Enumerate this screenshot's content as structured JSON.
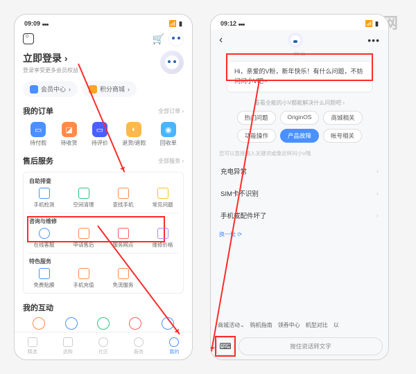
{
  "watermark": "爱创根知识网",
  "left": {
    "status": {
      "time": "09:09"
    },
    "login": {
      "title": "立即登录",
      "arrow": "›",
      "subtitle": "登录享受更多会员权益"
    },
    "pills": {
      "member": "会员中心",
      "points": "积分商城",
      "chev": "›"
    },
    "orders": {
      "title": "我的订单",
      "more": "全部订单 ›",
      "items": [
        "待付款",
        "待收货",
        "待评价",
        "退货/退款",
        "回收单"
      ]
    },
    "services": {
      "title": "售后服务",
      "more": "全部服务 ›",
      "group1": {
        "label": "自助排查",
        "items": [
          "手机检测",
          "空间清理",
          "查找手机",
          "常见问题"
        ]
      },
      "group2": {
        "label": "咨询与维修",
        "items": [
          "在线客服",
          "申请售后",
          "服务网点",
          "维修价格"
        ]
      },
      "group3": {
        "label": "特色服务",
        "items": [
          "免费贴膜",
          "手机充值",
          "免流服务"
        ]
      }
    },
    "inter": {
      "title": "我的互动"
    },
    "nav": [
      "精选",
      "选购",
      "社区",
      "服务",
      "我的"
    ]
  },
  "right": {
    "status": {
      "time": "09:12"
    },
    "chat_time": "09:11",
    "bubble": "Hi，亲爱的V粉，新年快乐！有什么问题，不妨问问小V吧~",
    "help": "看看全能的小V都能解决什么问题吧 ›",
    "chips": [
      "热门问题",
      "OriginOS",
      "商城相关",
      "功能操作",
      "产品故障",
      "帐号相关"
    ],
    "hint": "您可以直接输入关键词或像这样问小V哦",
    "list": [
      "充电异常",
      "SIM卡不识别",
      "手机或配件坏了"
    ],
    "refresh": "换一批 ⟳",
    "bottom_chips": [
      "商城活动⌄",
      "购机指南",
      "领券中心",
      "机型对比",
      "以"
    ],
    "voice": "按住说话转文字"
  }
}
